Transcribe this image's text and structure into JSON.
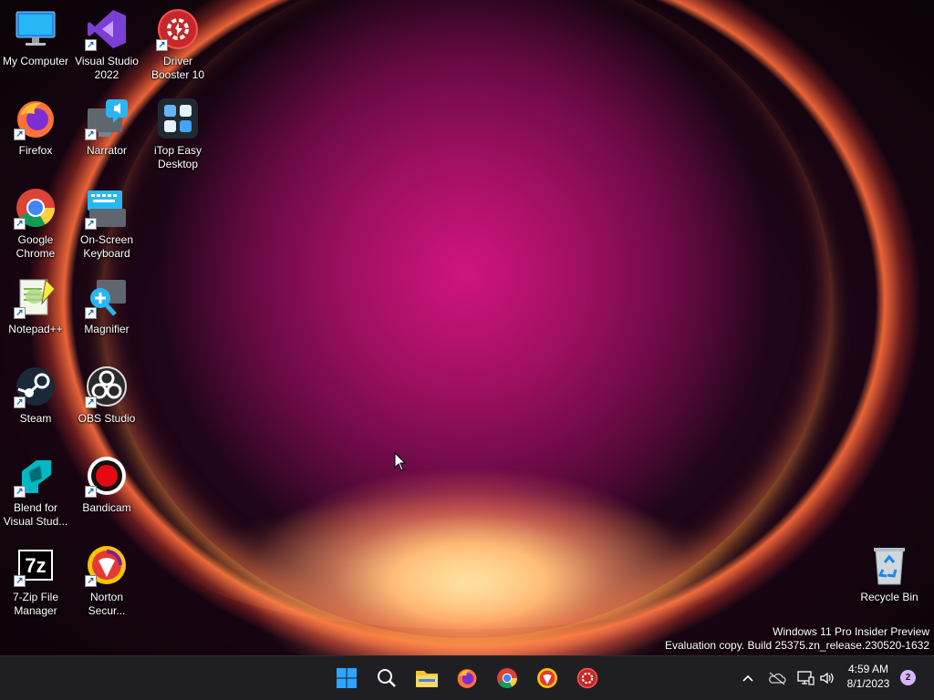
{
  "desktop": {
    "icons": [
      {
        "label": "My Computer",
        "icon": "monitor-icon"
      },
      {
        "label": "Visual Studio 2022",
        "icon": "visual-studio-icon"
      },
      {
        "label": "Driver Booster 10",
        "icon": "driver-booster-icon"
      },
      {
        "label": "Firefox",
        "icon": "firefox-icon"
      },
      {
        "label": "Narrator",
        "icon": "narrator-icon"
      },
      {
        "label": "iTop Easy Desktop",
        "icon": "itop-easy-desktop-icon"
      },
      {
        "label": "Google Chrome",
        "icon": "chrome-icon"
      },
      {
        "label": "On-Screen Keyboard",
        "icon": "on-screen-keyboard-icon"
      },
      {
        "label": "Notepad++",
        "icon": "notepadpp-icon"
      },
      {
        "label": "Magnifier",
        "icon": "magnifier-icon"
      },
      {
        "label": "Steam",
        "icon": "steam-icon"
      },
      {
        "label": "OBS Studio",
        "icon": "obs-studio-icon"
      },
      {
        "label": "Blend for Visual Stud...",
        "icon": "blend-icon"
      },
      {
        "label": "Bandicam",
        "icon": "bandicam-icon"
      },
      {
        "label": "7-Zip File Manager",
        "icon": "seven-zip-icon"
      },
      {
        "label": "Norton Secur...",
        "icon": "norton-icon"
      },
      {
        "label": "Recycle Bin",
        "icon": "recycle-bin-icon"
      }
    ]
  },
  "watermark": {
    "line1": "Windows 11 Pro Insider Preview",
    "line2": "Evaluation copy. Build 25375.zn_release.230520-1632"
  },
  "taskbar": {
    "pinned": [
      "start-icon",
      "search-icon",
      "file-explorer-icon",
      "firefox-icon",
      "chrome-icon",
      "norton-icon",
      "driver-booster-icon"
    ],
    "tray": [
      "chevron-up-icon",
      "onedrive-offline-icon",
      "network-icon",
      "volume-icon"
    ],
    "clock": {
      "time": "4:59 AM",
      "date": "8/1/2023"
    },
    "notification_count": "2"
  },
  "colors": {
    "accent": "#0078d4",
    "taskbar": "#1f1f22",
    "badge": "#d8b6ff"
  }
}
